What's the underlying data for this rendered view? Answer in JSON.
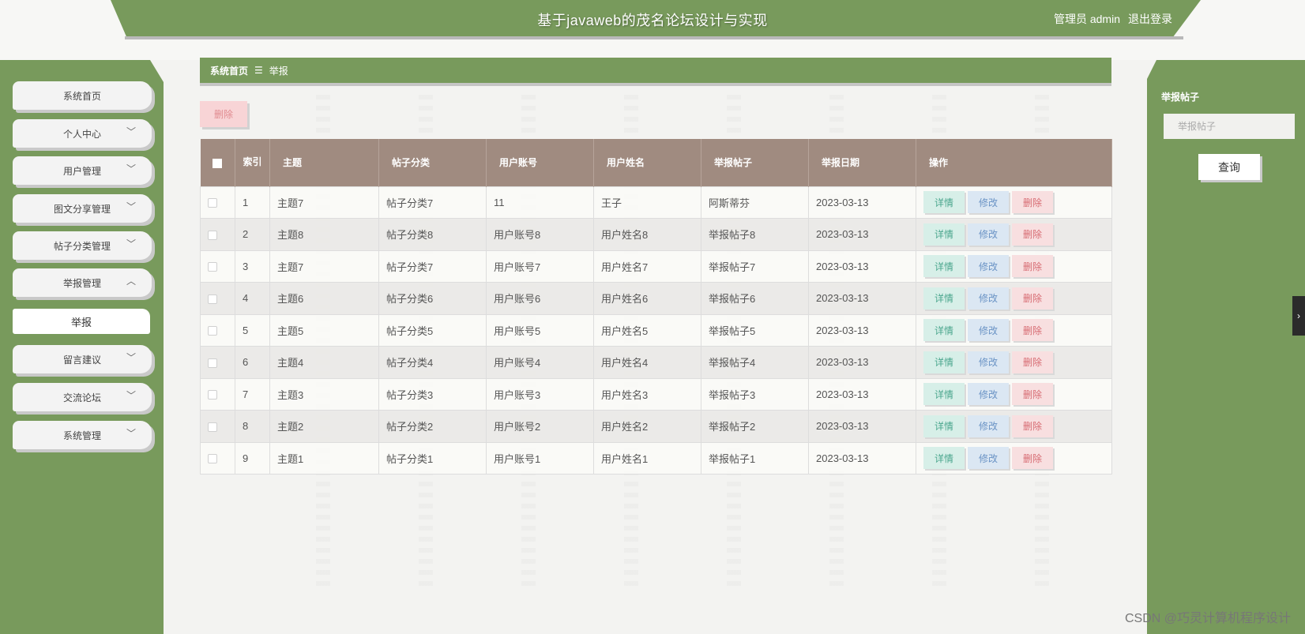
{
  "header": {
    "title": "基于javaweb的茂名论坛设计与实现",
    "user_label": "管理员 admin",
    "logout": "退出登录"
  },
  "sidebar": {
    "items": [
      {
        "label": "系统首页",
        "has_chevron": false
      },
      {
        "label": "个人中心",
        "has_chevron": true,
        "chevron": "﹀"
      },
      {
        "label": "用户管理",
        "has_chevron": true,
        "chevron": "﹀"
      },
      {
        "label": "图文分享管理",
        "has_chevron": true,
        "chevron": "﹀"
      },
      {
        "label": "帖子分类管理",
        "has_chevron": true,
        "chevron": "﹀"
      },
      {
        "label": "举报管理",
        "has_chevron": true,
        "chevron": "︿"
      },
      {
        "label": "留言建议",
        "has_chevron": true,
        "chevron": "﹀"
      },
      {
        "label": "交流论坛",
        "has_chevron": true,
        "chevron": "﹀"
      },
      {
        "label": "系统管理",
        "has_chevron": true,
        "chevron": "﹀"
      }
    ],
    "submenu": {
      "label": "举报"
    }
  },
  "breadcrumb": {
    "home": "系统首页",
    "separator": "☰",
    "current": "举报"
  },
  "toolbar": {
    "delete_label": "删除"
  },
  "table": {
    "columns": [
      "索引",
      "主题",
      "帖子分类",
      "用户账号",
      "用户姓名",
      "举报帖子",
      "举报日期",
      "操作"
    ],
    "rows": [
      [
        "1",
        "主题7",
        "帖子分类7",
        "11",
        "王子",
        "阿斯蒂芬",
        "2023-03-13"
      ],
      [
        "2",
        "主题8",
        "帖子分类8",
        "用户账号8",
        "用户姓名8",
        "举报帖子8",
        "2023-03-13"
      ],
      [
        "3",
        "主题7",
        "帖子分类7",
        "用户账号7",
        "用户姓名7",
        "举报帖子7",
        "2023-03-13"
      ],
      [
        "4",
        "主题6",
        "帖子分类6",
        "用户账号6",
        "用户姓名6",
        "举报帖子6",
        "2023-03-13"
      ],
      [
        "5",
        "主题5",
        "帖子分类5",
        "用户账号5",
        "用户姓名5",
        "举报帖子5",
        "2023-03-13"
      ],
      [
        "6",
        "主题4",
        "帖子分类4",
        "用户账号4",
        "用户姓名4",
        "举报帖子4",
        "2023-03-13"
      ],
      [
        "7",
        "主题3",
        "帖子分类3",
        "用户账号3",
        "用户姓名3",
        "举报帖子3",
        "2023-03-13"
      ],
      [
        "8",
        "主题2",
        "帖子分类2",
        "用户账号2",
        "用户姓名2",
        "举报帖子2",
        "2023-03-13"
      ],
      [
        "9",
        "主题1",
        "帖子分类1",
        "用户账号1",
        "用户姓名1",
        "举报帖子1",
        "2023-03-13"
      ]
    ],
    "actions": {
      "detail": "详情",
      "edit": "修改",
      "delete": "删除"
    }
  },
  "search": {
    "label": "举报帖子",
    "placeholder": "举报帖子",
    "button": "查询"
  },
  "side_toggle": "›",
  "watermark": "CSDN @巧灵计算机程序设计",
  "colors": {
    "primary_green": "#789a5c",
    "table_header": "#a08b80",
    "detail": "#4aa68d",
    "edit": "#6a93c5",
    "delete": "#d76b72"
  }
}
